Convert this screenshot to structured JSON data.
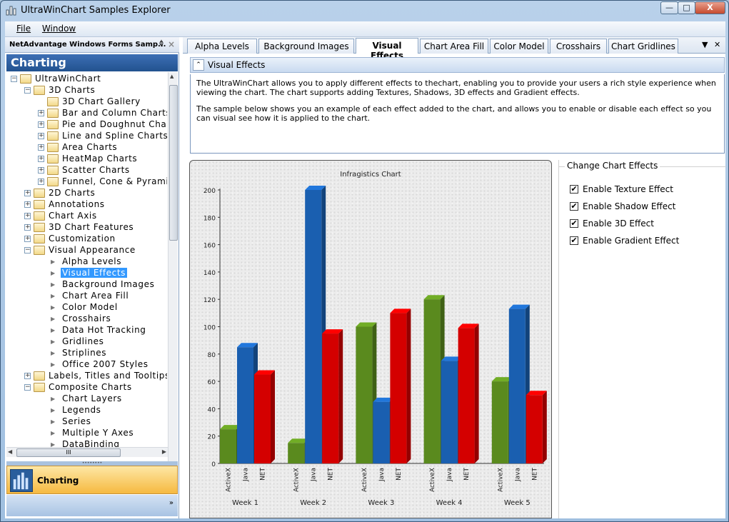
{
  "window": {
    "title": "UltraWinChart Samples Explorer",
    "minimize": "—",
    "maximize": "□",
    "close": "X"
  },
  "menu": {
    "file": "File",
    "window": "Window"
  },
  "left_pane": {
    "header": "NetAdvantage Windows Forms Samp...",
    "pin": "ᛰ",
    "close": "×",
    "banner": "Charting",
    "tree": [
      {
        "label": "UltraWinChart",
        "level": 0,
        "kind": "folder",
        "expander": "−"
      },
      {
        "label": "3D Charts",
        "level": 1,
        "kind": "folder",
        "expander": "−"
      },
      {
        "label": "3D Chart Gallery",
        "level": 2,
        "kind": "folder",
        "expander": ""
      },
      {
        "label": "Bar and Column Charts",
        "level": 2,
        "kind": "folder",
        "expander": "+"
      },
      {
        "label": "Pie and Doughnut Chart",
        "level": 2,
        "kind": "folder",
        "expander": "+"
      },
      {
        "label": "Line and Spline Charts",
        "level": 2,
        "kind": "folder",
        "expander": "+"
      },
      {
        "label": "Area Charts",
        "level": 2,
        "kind": "folder",
        "expander": "+"
      },
      {
        "label": "HeatMap Charts",
        "level": 2,
        "kind": "folder",
        "expander": "+"
      },
      {
        "label": "Scatter Charts",
        "level": 2,
        "kind": "folder",
        "expander": "+"
      },
      {
        "label": "Funnel, Cone & Pyramid",
        "level": 2,
        "kind": "folder",
        "expander": "+"
      },
      {
        "label": "2D Charts",
        "level": 1,
        "kind": "folder",
        "expander": "+"
      },
      {
        "label": "Annotations",
        "level": 1,
        "kind": "folder",
        "expander": "+"
      },
      {
        "label": "Chart Axis",
        "level": 1,
        "kind": "folder",
        "expander": "+"
      },
      {
        "label": "3D Chart Features",
        "level": 1,
        "kind": "folder",
        "expander": "+"
      },
      {
        "label": "Customization",
        "level": 1,
        "kind": "folder",
        "expander": "+"
      },
      {
        "label": "Visual Appearance",
        "level": 1,
        "kind": "folder",
        "expander": "−"
      },
      {
        "label": "Alpha Levels",
        "level": 2,
        "kind": "leaf"
      },
      {
        "label": "Visual Effects",
        "level": 2,
        "kind": "leaf",
        "selected": true
      },
      {
        "label": "Background Images",
        "level": 2,
        "kind": "leaf"
      },
      {
        "label": "Chart Area Fill",
        "level": 2,
        "kind": "leaf"
      },
      {
        "label": "Color Model",
        "level": 2,
        "kind": "leaf"
      },
      {
        "label": "Crosshairs",
        "level": 2,
        "kind": "leaf"
      },
      {
        "label": "Data Hot Tracking",
        "level": 2,
        "kind": "leaf"
      },
      {
        "label": "Gridlines",
        "level": 2,
        "kind": "leaf"
      },
      {
        "label": "Striplines",
        "level": 2,
        "kind": "leaf"
      },
      {
        "label": "Office 2007 Styles",
        "level": 2,
        "kind": "leaf"
      },
      {
        "label": "Labels, Titles and Tooltips",
        "level": 1,
        "kind": "folder",
        "expander": "+"
      },
      {
        "label": "Composite Charts",
        "level": 1,
        "kind": "folder",
        "expander": "−"
      },
      {
        "label": "Chart Layers",
        "level": 2,
        "kind": "leaf"
      },
      {
        "label": "Legends",
        "level": 2,
        "kind": "leaf"
      },
      {
        "label": "Series",
        "level": 2,
        "kind": "leaf"
      },
      {
        "label": "Multiple Y Axes",
        "level": 2,
        "kind": "leaf"
      },
      {
        "label": "DataBinding",
        "level": 2,
        "kind": "leaf"
      }
    ],
    "hscroll_grip": "III",
    "splitter_grip": "••••••••",
    "charting_button": "Charting",
    "footer_chevron": "»"
  },
  "tabs": {
    "items": [
      "Alpha Levels",
      "Background Images",
      "Visual Effects",
      "Color Model",
      "Chart Area Fill",
      "Crosshairs",
      "Chart Gridlines"
    ],
    "order": [
      "Alpha Levels",
      "Background Images",
      "Visual Effects",
      "Chart Area Fill",
      "Color Model",
      "Crosshairs",
      "Chart Gridlines"
    ],
    "active": "Visual Effects",
    "dropdown": "▼",
    "close": "✕"
  },
  "panel": {
    "header": "Visual Effects",
    "collapse_icon": "⌃",
    "desc1": "The UltraWinChart allows you to apply different effects to thechart, enabling you to provide your users a rich style experience when viewing the chart.  The chart supports adding Textures, Shadows, 3D effects and Gradient effects.",
    "desc2": "The sample below shows you an example of each effect added to the chart, and allows you to enable or disable each effect so you can visual see how it is applied to the chart."
  },
  "effects": {
    "group_title": "Change Chart Effects",
    "items": [
      {
        "label": "Enable Texture Effect",
        "checked": true
      },
      {
        "label": "Enable Shadow Effect",
        "checked": true
      },
      {
        "label": "Enable 3D Effect",
        "checked": true
      },
      {
        "label": "Enable Gradient Effect",
        "checked": true
      }
    ],
    "check_glyph": "✔"
  },
  "chart_data": {
    "type": "bar",
    "title": "Infragistics Chart",
    "xlabel": "",
    "ylabel": "",
    "ylim": [
      0,
      200
    ],
    "yticks": [
      0,
      20,
      40,
      60,
      80,
      100,
      120,
      140,
      160,
      180,
      200
    ],
    "categories": [
      "Week 1",
      "Week 2",
      "Week 3",
      "Week 4",
      "Week 5"
    ],
    "series": [
      {
        "name": "ActiveX",
        "color": "#5a8a1e",
        "values": [
          25,
          15,
          100,
          120,
          60
        ]
      },
      {
        "name": "Java",
        "color": "#1a5fb0",
        "values": [
          85,
          200,
          45,
          75,
          113
        ]
      },
      {
        "name": "NET",
        "color": "#d40000",
        "values": [
          65,
          95,
          110,
          99,
          50
        ]
      }
    ],
    "grid": false,
    "legend": "none"
  }
}
